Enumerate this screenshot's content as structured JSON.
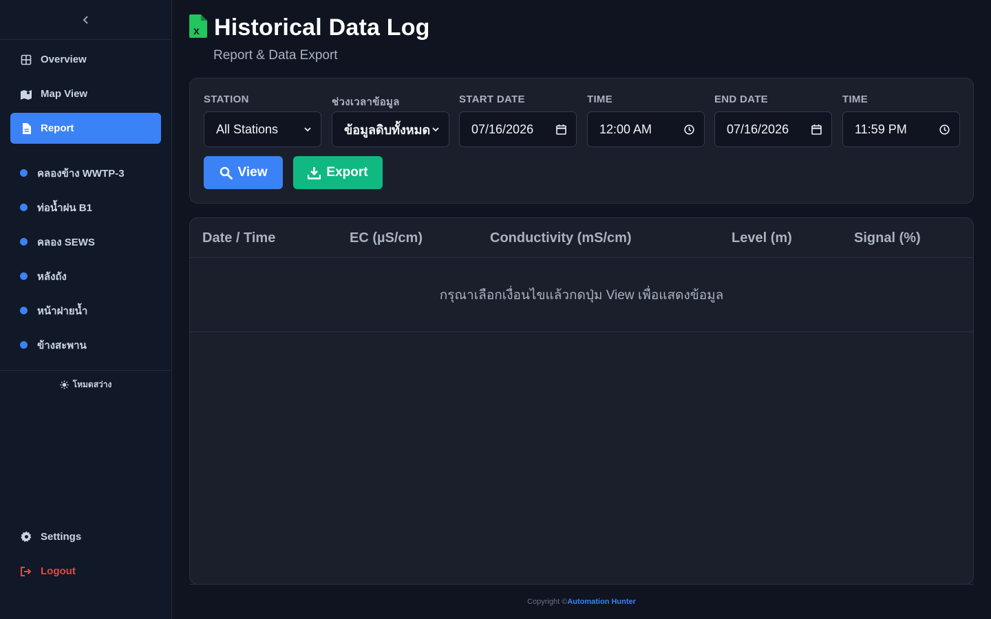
{
  "sidebar": {
    "nav": [
      {
        "label": "Overview",
        "icon": "grid-icon"
      },
      {
        "label": "Map View",
        "icon": "map-icon"
      },
      {
        "label": "Report",
        "icon": "file-icon",
        "active": true
      }
    ],
    "stations": [
      {
        "label": "คลองข้าง WWTP-3"
      },
      {
        "label": "ท่อน้ำฝน B1"
      },
      {
        "label": "คลอง SEWS"
      },
      {
        "label": "หลังถัง"
      },
      {
        "label": "หน้าฝายน้ำ"
      },
      {
        "label": "ข้างสะพาน"
      }
    ],
    "theme_toggle": "โหมดสว่าง",
    "settings_label": "Settings",
    "logout_label": "Logout"
  },
  "header": {
    "title": "Historical Data Log",
    "subtitle": "Report & Data Export"
  },
  "filters": {
    "station_label": "STATION",
    "station_value": "All Stations",
    "period_label": "ช่วงเวลาข้อมูล",
    "period_value": "ข้อมูลดิบทั้งหมด",
    "start_date_label": "START DATE",
    "start_date_value": "07/16/2026",
    "start_time_label": "TIME",
    "start_time_value": "12:00 AM",
    "end_date_label": "END DATE",
    "end_date_value": "07/16/2026",
    "end_time_label": "TIME",
    "end_time_value": "11:59 PM",
    "view_label": "View",
    "export_label": "Export"
  },
  "table": {
    "columns": [
      "Date / Time",
      "EC (µS/cm)",
      "Conductivity (mS/cm)",
      "Level (m)",
      "Signal (%)"
    ],
    "empty_message": "กรุณาเลือกเงื่อนไขแล้วกดปุ่ม View เพื่อแสดงข้อมูล"
  },
  "footer": {
    "copyright": "Copyright ©",
    "brand": "Automation Hunter"
  },
  "colors": {
    "accent": "#3b82f6",
    "export": "#10b981",
    "logout": "#ef4444",
    "excel_icon": "#22c55e"
  }
}
